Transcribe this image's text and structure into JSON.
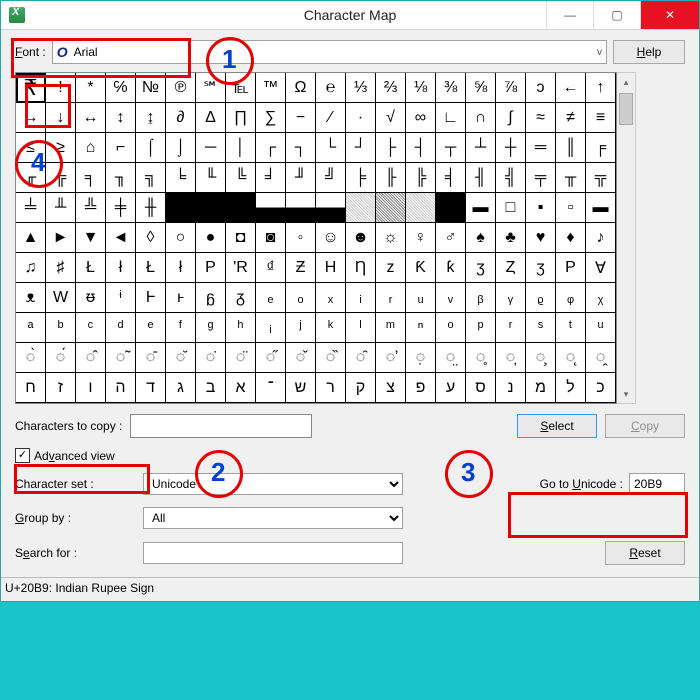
{
  "window": {
    "title": "Character Map",
    "minimize": "—",
    "maximize": "▢",
    "close": "✕"
  },
  "font_row": {
    "label": "Font :",
    "value": "Arial",
    "chevron": "v",
    "help_label": "Help"
  },
  "grid_rows": [
    [
      "₹",
      "!",
      "*",
      "℅",
      "№",
      "℗",
      "℠",
      "℡",
      "™",
      "Ω",
      "℮",
      "⅓",
      "⅔",
      "⅛",
      "⅜",
      "⅝",
      "⅞",
      "ↄ",
      "←",
      "↑"
    ],
    [
      "→",
      "↓",
      "↔",
      "↕",
      "↨",
      "∂",
      "∆",
      "∏",
      "∑",
      "−",
      "∕",
      "∙",
      "√",
      "∞",
      "∟",
      "∩",
      "∫",
      "≈",
      "≠",
      "≡"
    ],
    [
      "≤",
      "≥",
      "⌂",
      "⌐",
      "⌠",
      "⌡",
      "─",
      "│",
      "┌",
      "┐",
      "└",
      "┘",
      "├",
      "┤",
      "┬",
      "┴",
      "┼",
      "═",
      "║",
      "╒"
    ],
    [
      "╓",
      "╔",
      "╕",
      "╖",
      "╗",
      "╘",
      "╙",
      "╚",
      "╛",
      "╜",
      "╝",
      "╞",
      "╟",
      "╠",
      "╡",
      "╢",
      "╣",
      "╤",
      "╥",
      "╦"
    ],
    [
      "╧",
      "╨",
      "╩",
      "╪",
      "╫",
      "╬",
      "",
      "",
      "",
      "",
      "",
      "",
      "",
      "",
      "",
      "▬",
      "□",
      "▪",
      "▫",
      "▬"
    ],
    [
      "▲",
      "►",
      "▼",
      "◄",
      "◊",
      "○",
      "●",
      "◘",
      "◙",
      "◦",
      "☺",
      "☻",
      "☼",
      "♀",
      "♂",
      "♠",
      "♣",
      "♥",
      "♦",
      "♪"
    ],
    [
      "♫",
      "♯",
      "Ł",
      "ł",
      "Ł",
      "ł",
      "P",
      "'R",
      "₫",
      "Ƶ",
      "H",
      "Ƞ",
      "z",
      "Ƙ",
      "ƙ",
      "ʒ",
      "Ȥ",
      "ʒ",
      "P",
      "Ɐ"
    ],
    [
      "ᴥ",
      "W",
      "ᵿ",
      "ᶤ",
      "Ⱶ",
      "ⱶ",
      "ᵷ",
      "ᵹ",
      "ₑ",
      "ₒ",
      "ₓ",
      "ᵢ",
      "ᵣ",
      "ᵤ",
      "ᵥ",
      "ᵦ",
      "ᵧ",
      "ᵨ",
      "ᵩ",
      "ᵪ"
    ],
    [
      "ᵃ",
      "ᵇ",
      "ᶜ",
      "ᵈ",
      "ᵉ",
      "ᶠ",
      "ᵍ",
      "ʰ",
      "ᵢ",
      "ʲ",
      "ᵏ",
      "ˡ",
      "ᵐ",
      "ⁿ",
      "ᵒ",
      "ᵖ",
      "ʳ",
      "ˢ",
      "ᵗ",
      "ᵘ"
    ],
    [
      "◌̀",
      "◌́",
      "◌̂",
      "◌̃",
      "◌̄",
      "◌̆",
      "◌̇",
      "◌̈",
      "◌̋",
      "◌̌",
      "◌̏",
      "◌̑",
      "◌̛",
      "◌̣",
      "◌̤",
      "◌̥",
      "◌̦",
      "◌̧",
      "◌̨",
      "◌̭"
    ],
    [
      "ח",
      "ז",
      "ו",
      "ה",
      "ד",
      "ג",
      "ב",
      "א",
      "־",
      "ש",
      "ר",
      "ק",
      "צ",
      "פ",
      "ע",
      "ס",
      "נ",
      "מ",
      "ל",
      "כ"
    ]
  ],
  "shade_row4": {
    "5": "blk",
    "6": "blk",
    "7": "blk",
    "8": "half",
    "9": "half",
    "10": "half",
    "11": "light",
    "12": "med",
    "13": "light",
    "14": "blk"
  },
  "copy": {
    "label": "Characters to copy :",
    "select_label": "Select",
    "copy_label": "Copy"
  },
  "advanced": {
    "label": "Advanced view"
  },
  "charset": {
    "label": "Character set :",
    "value": "Unicode"
  },
  "goto": {
    "label": "Go to Unicode :",
    "value": "20B9"
  },
  "groupby": {
    "label": "Group by :",
    "value": "All"
  },
  "search": {
    "label": "Search for :",
    "reset_label": "Reset",
    "placeholder": ""
  },
  "status": "U+20B9: Indian Rupee Sign",
  "annotations": {
    "n1": "1",
    "n2": "2",
    "n3": "3",
    "n4": "4"
  }
}
